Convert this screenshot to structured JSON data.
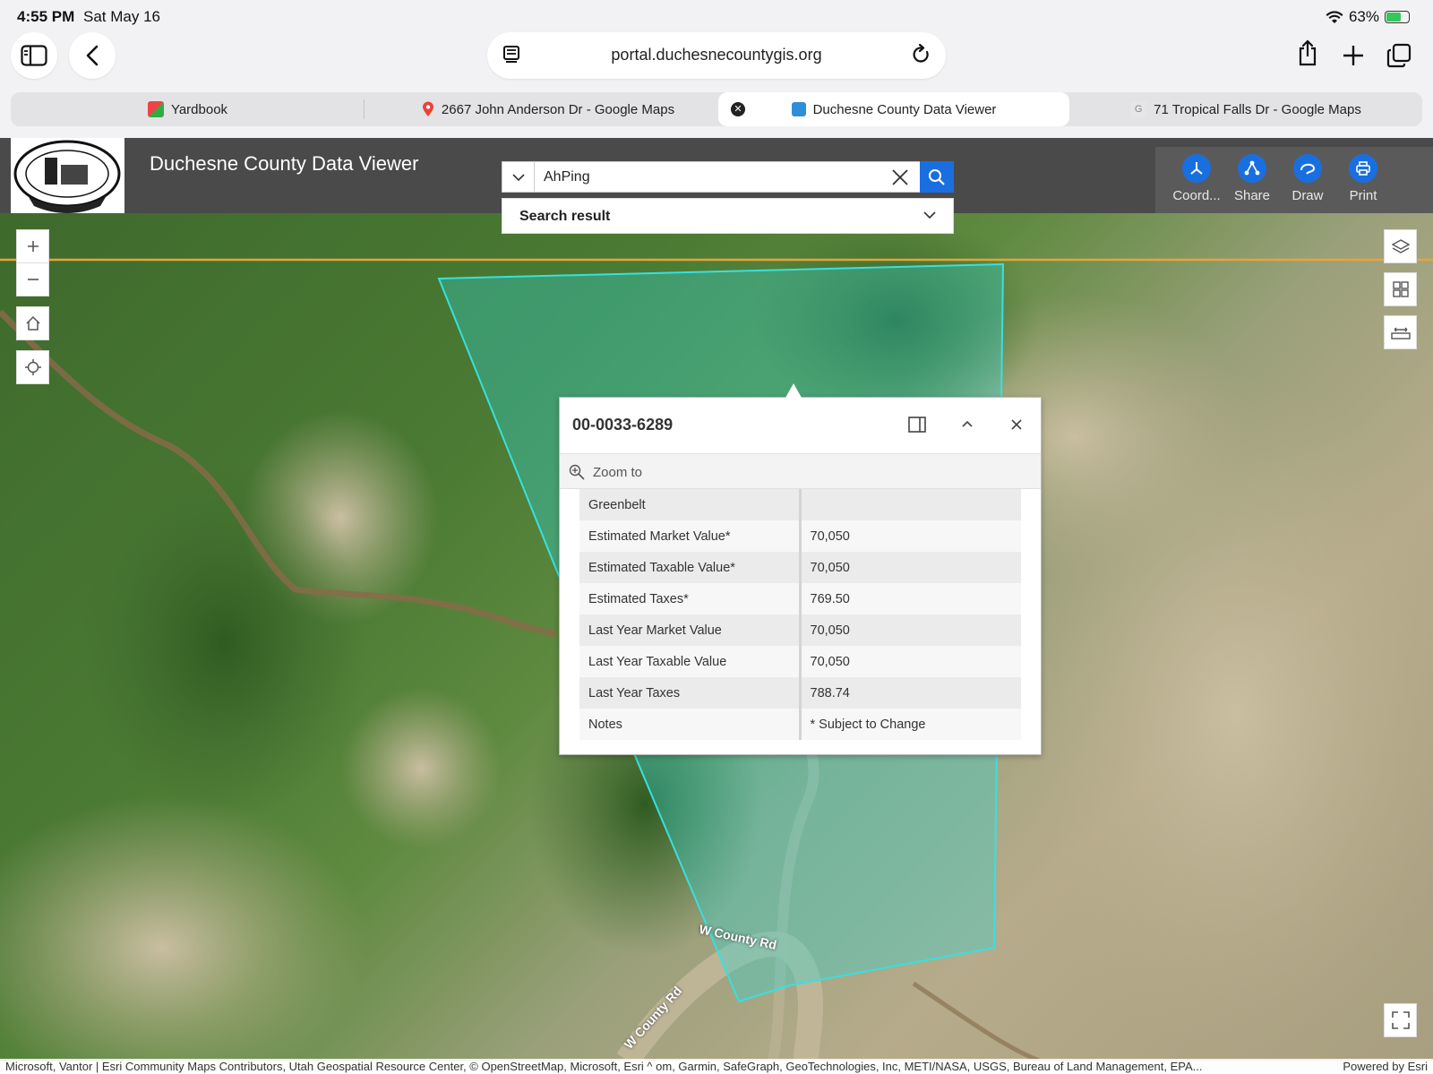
{
  "status": {
    "time": "4:55 PM",
    "date": "Sat May 16",
    "battery": "63%"
  },
  "browser": {
    "url": "portal.duchesnecountygis.org",
    "tabs": [
      {
        "label": "Yardbook"
      },
      {
        "label": "2667 John Anderson Dr - Google Maps"
      },
      {
        "label": "Duchesne County Data Viewer"
      },
      {
        "label": "71 Tropical Falls Dr - Google Maps"
      }
    ]
  },
  "app": {
    "title": "Duchesne County Data Viewer",
    "tools": [
      {
        "label": "Coord...",
        "icon": "coordinates-icon"
      },
      {
        "label": "Share",
        "icon": "share-icon"
      },
      {
        "label": "Draw",
        "icon": "draw-icon"
      },
      {
        "label": "Print",
        "icon": "print-icon"
      }
    ]
  },
  "search": {
    "value": "AhPing",
    "result_label": "Search result"
  },
  "popup": {
    "title": "00-0033-6289",
    "zoom_label": "Zoom to",
    "rows": [
      {
        "key": "Greenbelt",
        "value": ""
      },
      {
        "key": "Estimated Market Value*",
        "value": "70,050"
      },
      {
        "key": "Estimated Taxable Value*",
        "value": "70,050"
      },
      {
        "key": "Estimated Taxes*",
        "value": "769.50"
      },
      {
        "key": "Last Year Market Value",
        "value": "70,050"
      },
      {
        "key": "Last Year Taxable Value",
        "value": "70,050"
      },
      {
        "key": "Last Year Taxes",
        "value": "788.74"
      },
      {
        "key": "Notes",
        "value": "* Subject to Change"
      }
    ]
  },
  "map": {
    "road_label_1": "W County Rd",
    "road_label_2": "W County Rd",
    "parcel_color": "#2fd6d6",
    "boundary_color": "#e8a33a"
  },
  "attribution": {
    "text": "Microsoft, Vantor | Esri Community Maps Contributors, Utah Geospatial Resource Center, © OpenStreetMap, Microsoft, Esri  ^  om, Garmin, SafeGraph, GeoTechnologies, Inc, METI/NASA, USGS, Bureau of Land Management, EPA...",
    "powered": "Powered by Esri"
  }
}
